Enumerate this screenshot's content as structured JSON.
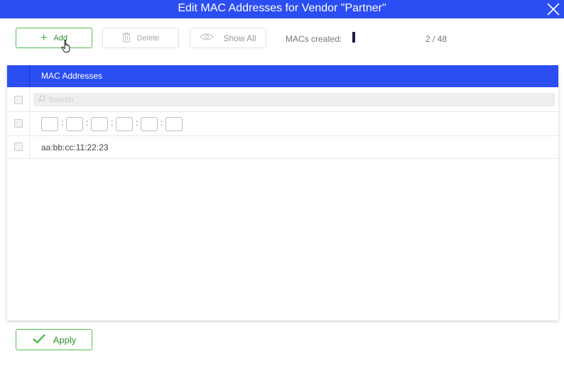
{
  "window": {
    "title": "Edit MAC Addresses for Vendor \"Partner\""
  },
  "toolbar": {
    "add_label": "Add",
    "delete_label": "Delete",
    "show_all_label": "Show All",
    "macs_created_label": "MACs created:",
    "counter_text": "2 / 48",
    "macs_created_progress": 0.042
  },
  "table": {
    "column_header": "MAC Addresses",
    "search_placeholder": "Search",
    "new_entry_octets": [
      "",
      "",
      "",
      "",
      "",
      ""
    ],
    "rows": [
      {
        "mac": "aa:bb:cc:11:22:23"
      }
    ]
  },
  "footer": {
    "apply_label": "Apply"
  },
  "colors": {
    "accent_blue": "#2b4ef2",
    "success_green": "#3cb83c",
    "progress_dark": "#1b1b4a"
  },
  "icons": [
    "close-icon",
    "plus-icon",
    "trash-icon",
    "eye-icon",
    "hand-cursor-icon",
    "search-icon",
    "checkmark-icon"
  ]
}
